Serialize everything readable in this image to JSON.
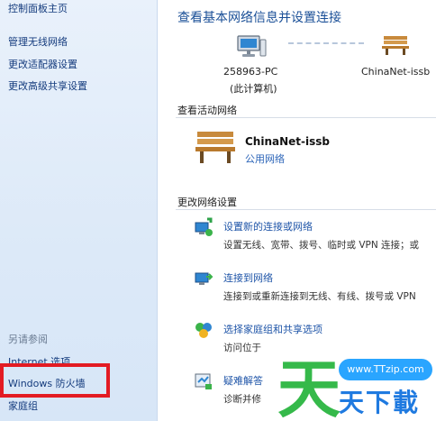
{
  "sidebar": {
    "home": "控制面板主页",
    "items": [
      {
        "label": "管理无线网络"
      },
      {
        "label": "更改适配器设置"
      },
      {
        "label": "更改高级共享设置"
      }
    ],
    "see_also_header": "另请参阅",
    "see_also": [
      {
        "label": "Internet 选项"
      },
      {
        "label": "Windows 防火墙"
      },
      {
        "label": "家庭组"
      }
    ]
  },
  "main": {
    "title": "查看基本网络信息并设置连接",
    "map": {
      "computer_name": "258963-PC",
      "computer_sub": "(此计算机)",
      "network_name": "ChinaNet-issb"
    },
    "active_section": "查看活动网络",
    "active": {
      "name": "ChinaNet-issb",
      "type": "公用网络"
    },
    "change_section": "更改网络设置",
    "tasks": [
      {
        "link": "设置新的连接或网络",
        "desc": "设置无线、宽带、拨号、临时或 VPN 连接；或"
      },
      {
        "link": "连接到网络",
        "desc": "连接到或重新连接到无线、有线、拨号或 VPN"
      },
      {
        "link": "选择家庭组和共享选项",
        "desc": "访问位于"
      },
      {
        "link": "疑难解答",
        "desc": "诊断并修"
      }
    ]
  },
  "watermark": {
    "url": "www.TTzip.com",
    "big_char": "天",
    "chars": "天下載"
  },
  "colors": {
    "link": "#1f55a8",
    "highlight_box": "#e31b23",
    "sidebar_bg": "#dce9f8"
  }
}
